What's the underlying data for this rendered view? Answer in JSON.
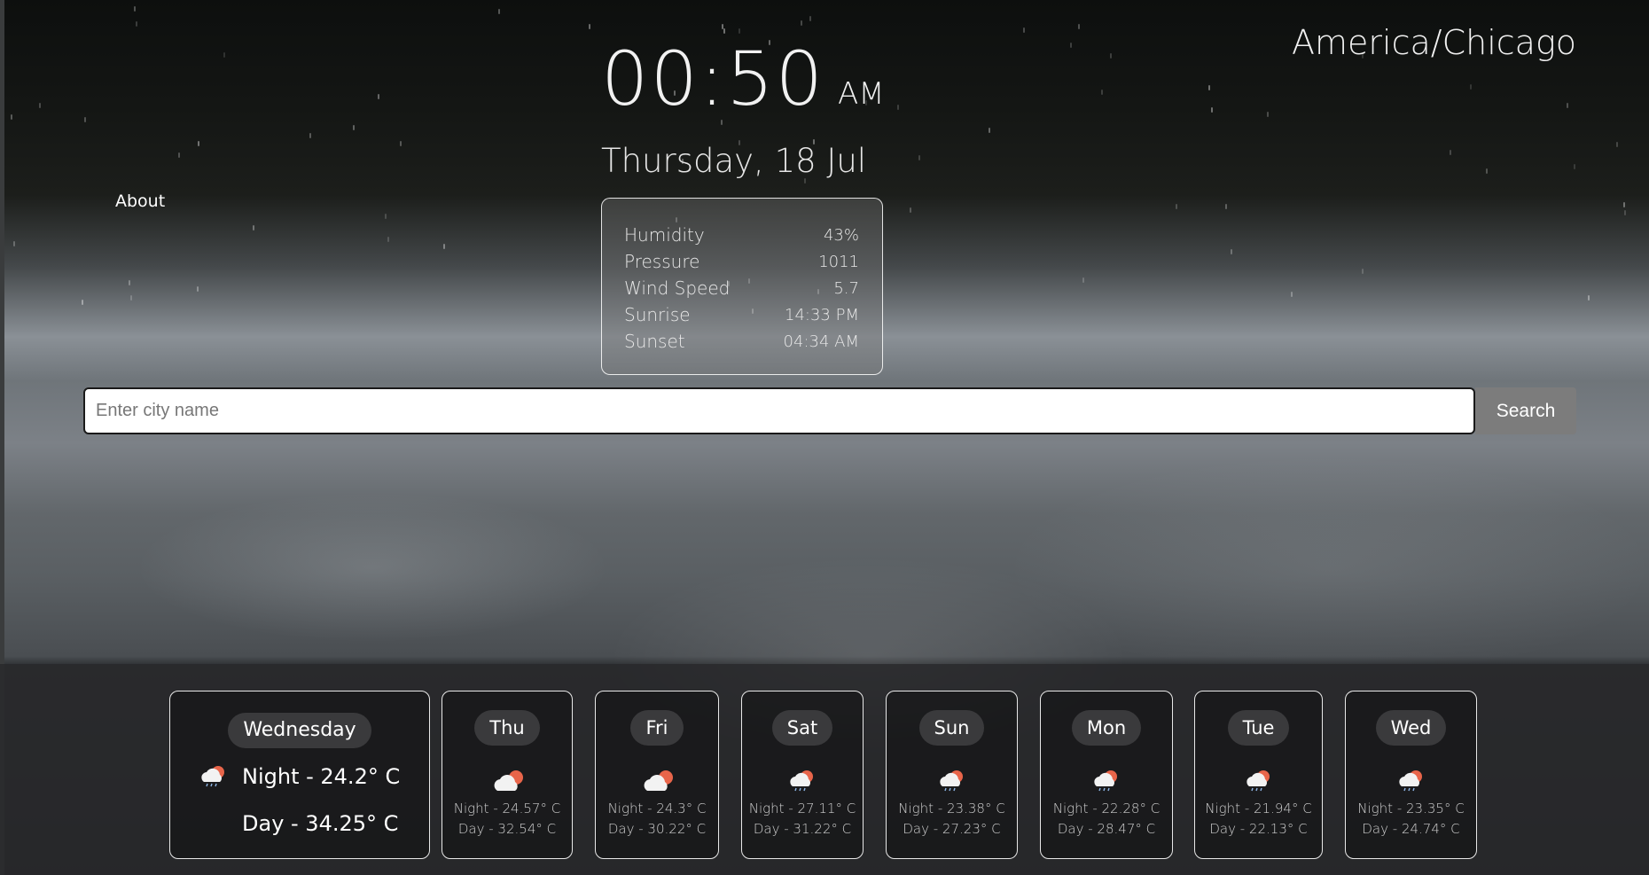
{
  "nav": {
    "about_label": "About"
  },
  "clock": {
    "time": "00:50",
    "ampm": "AM",
    "date": "Thursday, 18 Jul",
    "timezone": "America/Chicago"
  },
  "details": [
    {
      "label": "Humidity",
      "value": "43%"
    },
    {
      "label": "Pressure",
      "value": "1011"
    },
    {
      "label": "Wind Speed",
      "value": "5.7"
    },
    {
      "label": "Sunrise",
      "value": "14:33 PM"
    },
    {
      "label": "Sunset",
      "value": "04:34 AM"
    }
  ],
  "search": {
    "placeholder": "Enter city name",
    "value": "",
    "button_label": "Search"
  },
  "today": {
    "day": "Wednesday",
    "night": "Night - 24.2° C",
    "day_temp": "Day - 34.25° C",
    "icon": "cloud-sun-rain-icon"
  },
  "forecast": [
    {
      "day": "Thu",
      "night": "Night - 24.57° C",
      "day_temp": "Day - 32.54° C",
      "icon": "cloud-sun-icon"
    },
    {
      "day": "Fri",
      "night": "Night - 24.3° C",
      "day_temp": "Day - 30.22° C",
      "icon": "cloud-sun-icon"
    },
    {
      "day": "Sat",
      "night": "Night - 27.11° C",
      "day_temp": "Day - 31.22° C",
      "icon": "cloud-sun-rain-icon"
    },
    {
      "day": "Sun",
      "night": "Night - 23.38° C",
      "day_temp": "Day - 27.23° C",
      "icon": "cloud-sun-rain-icon"
    },
    {
      "day": "Mon",
      "night": "Night - 22.28° C",
      "day_temp": "Day - 28.47° C",
      "icon": "cloud-sun-rain-icon"
    },
    {
      "day": "Tue",
      "night": "Night - 21.94° C",
      "day_temp": "Day - 22.13° C",
      "icon": "cloud-sun-rain-icon"
    },
    {
      "day": "Wed",
      "night": "Night - 23.35° C",
      "day_temp": "Day - 24.74° C",
      "icon": "cloud-sun-rain-icon"
    }
  ],
  "colors": {
    "icon_sun": "#e8654a",
    "icon_cloud": "#f2f2f2",
    "rain": "#8fb6e6"
  }
}
